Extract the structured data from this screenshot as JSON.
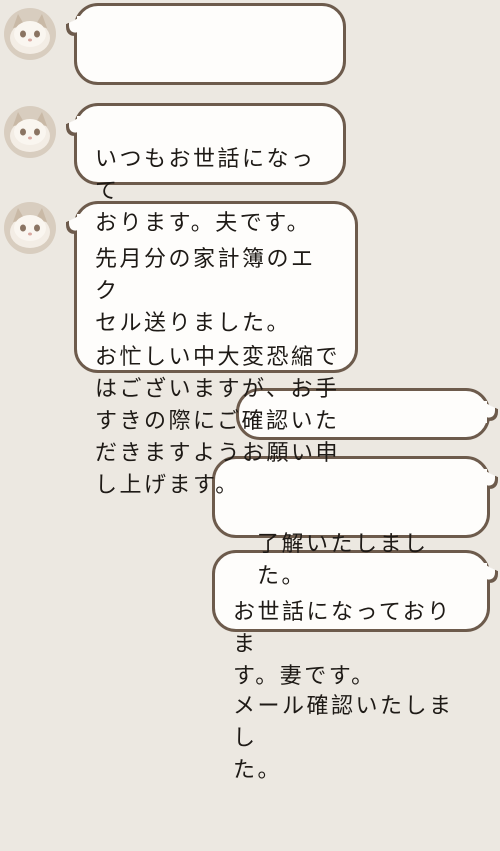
{
  "messages": [
    {
      "side": "left",
      "text": "いつもお世話になって\nおります。夫です。"
    },
    {
      "side": "left",
      "text": "先月分の家計簿のエク\nセル送りました。"
    },
    {
      "side": "left",
      "text": "お忙しい中大変恐縮で\nはございますが、お手\nすきの際にご確認いた\nだきますようお願い申\nし上げます。"
    },
    {
      "side": "right",
      "text": "了解いたしました。"
    },
    {
      "side": "right",
      "text": "お世話になっておりま\nす。妻です。"
    },
    {
      "side": "right",
      "text": "メール確認いたしまし\nた。"
    }
  ],
  "avatar": {
    "icon": "cat-avatar-icon"
  },
  "colors": {
    "background": "#ece8e1",
    "bubble": "#fefdfb",
    "border": "#6d5b4c",
    "text": "#1e1a16"
  }
}
